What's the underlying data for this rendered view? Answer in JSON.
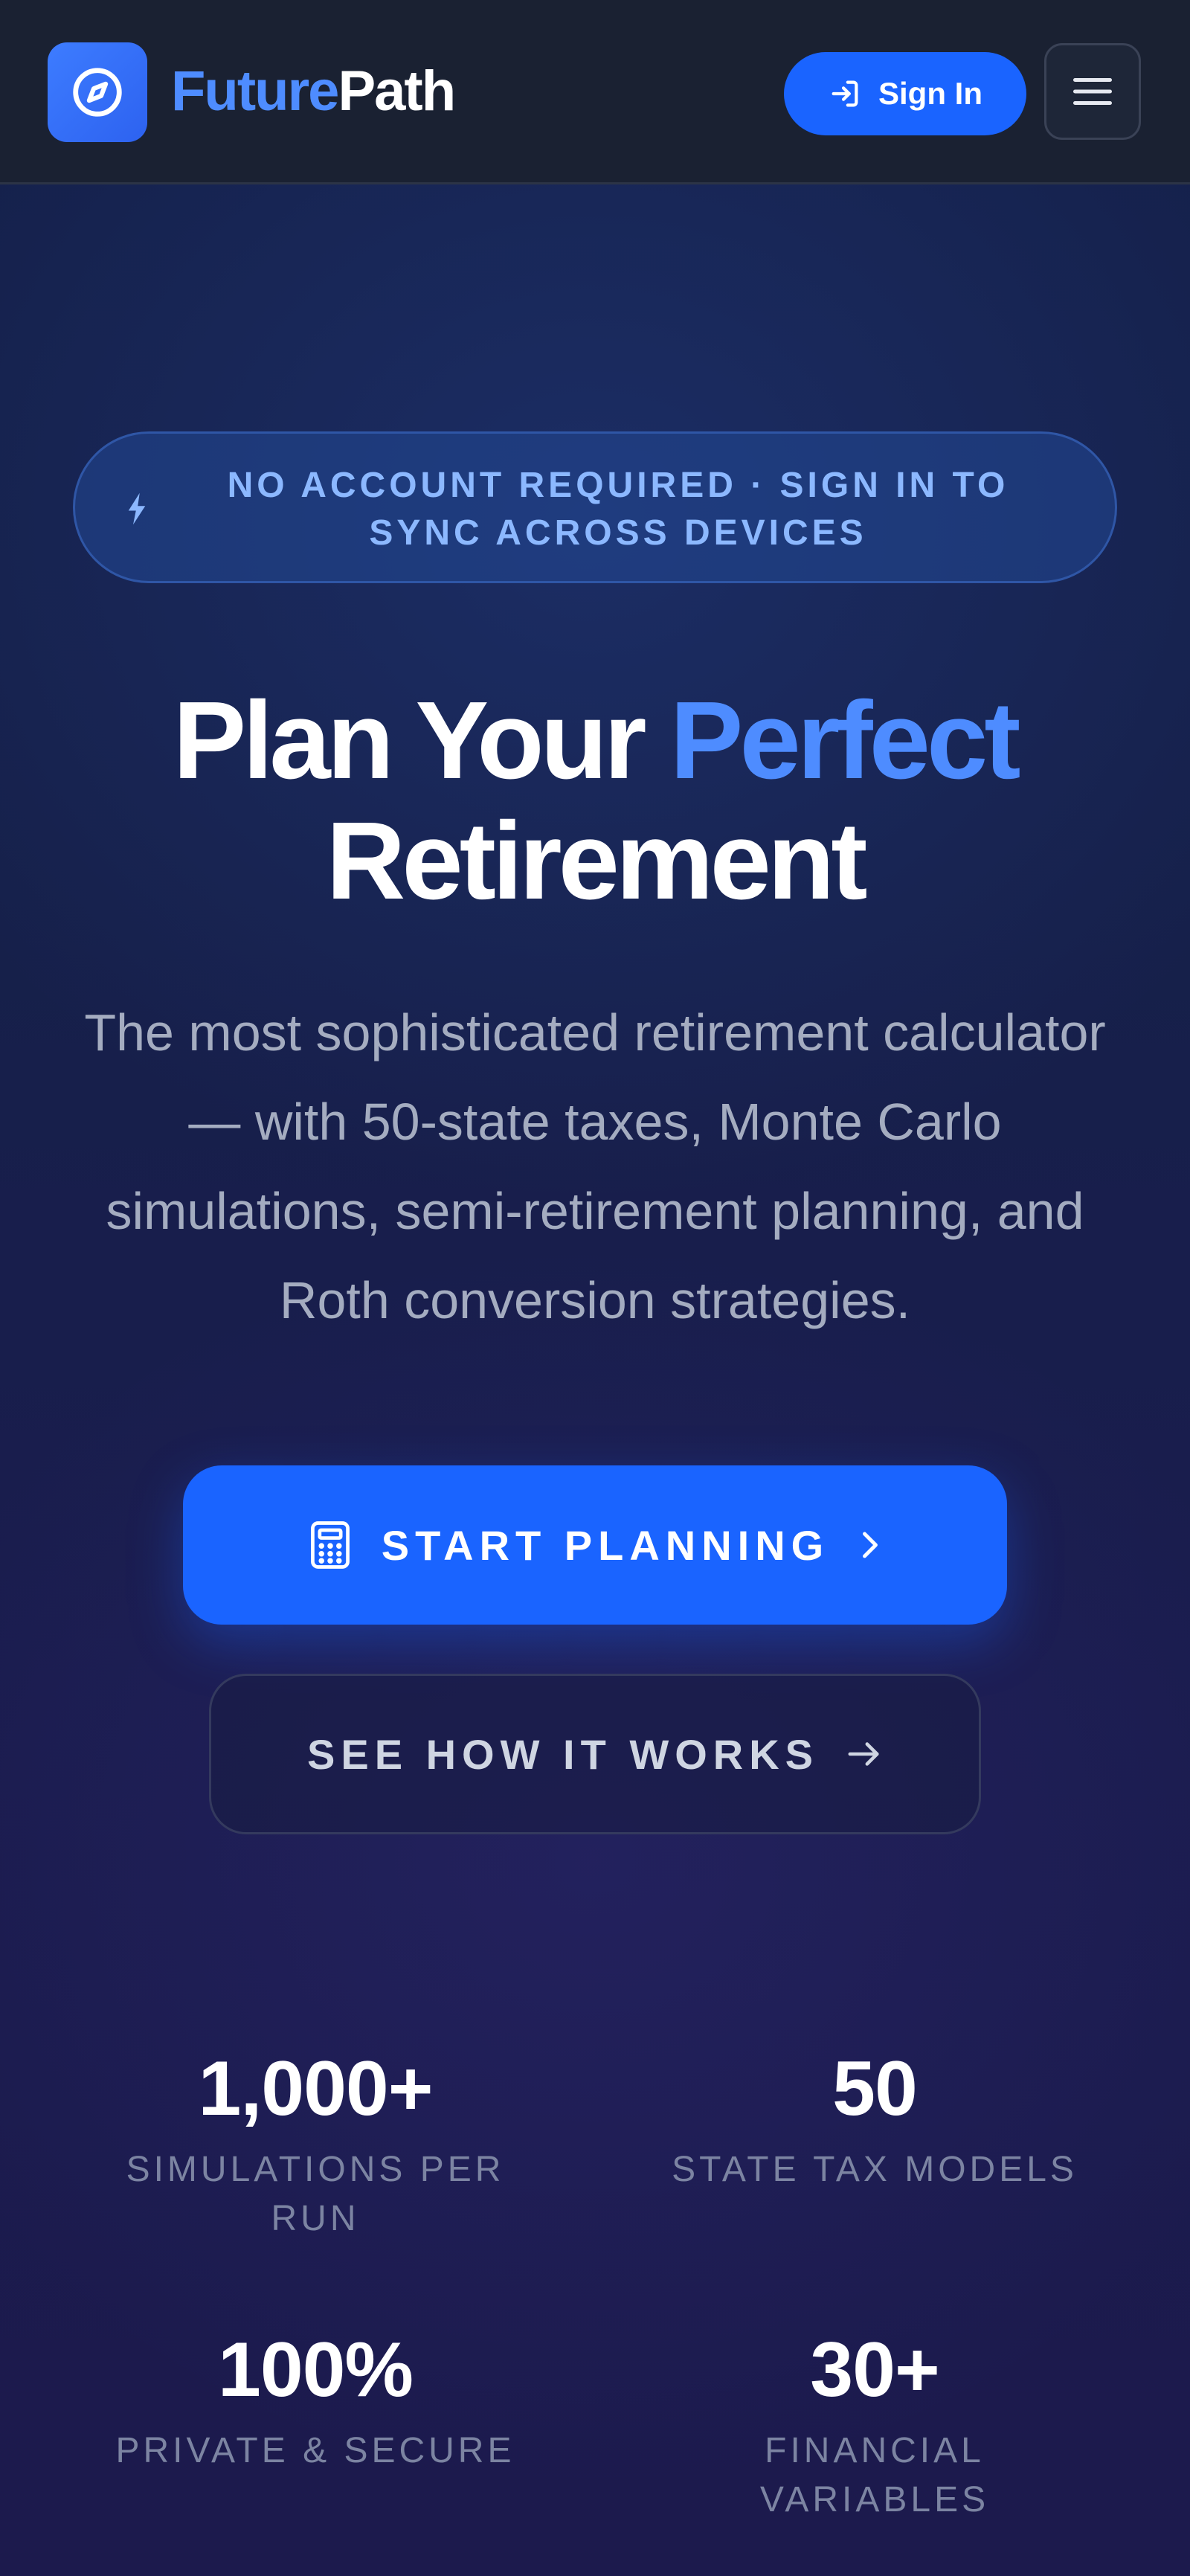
{
  "header": {
    "brand_part1": "Future",
    "brand_part2": "Path",
    "signin_label": "Sign In",
    "logo_icon": "compass-icon",
    "menu_icon": "hamburger-menu-icon"
  },
  "badge": {
    "icon": "lightning-icon",
    "text": "NO ACCOUNT REQUIRED · SIGN IN TO SYNC ACROSS DEVICES"
  },
  "hero": {
    "title_part1": "Plan Your ",
    "title_highlight": "Perfect",
    "title_part2": "Retirement",
    "subtitle": "The most sophisticated retirement calculator — with 50-state taxes, Monte Carlo simulations, semi-retirement planning, and Roth conversion strategies."
  },
  "cta": {
    "primary_label": "START PLANNING",
    "primary_icon": "calculator-icon",
    "secondary_label": "SEE HOW IT WORKS",
    "secondary_icon": "arrow-right-icon"
  },
  "stats": [
    {
      "value": "1,000+",
      "label": "SIMULATIONS PER RUN"
    },
    {
      "value": "50",
      "label": "STATE TAX MODELS"
    },
    {
      "value": "100%",
      "label": "PRIVATE & SECURE"
    },
    {
      "value": "30+",
      "label": "FINANCIAL VARIABLES"
    }
  ],
  "colors": {
    "accent": "#1a64ff",
    "brand_blue": "#4e8cff",
    "badge_text": "#8cb8ff",
    "header_bg": "#1a2132",
    "page_bg": "#171c3d"
  }
}
